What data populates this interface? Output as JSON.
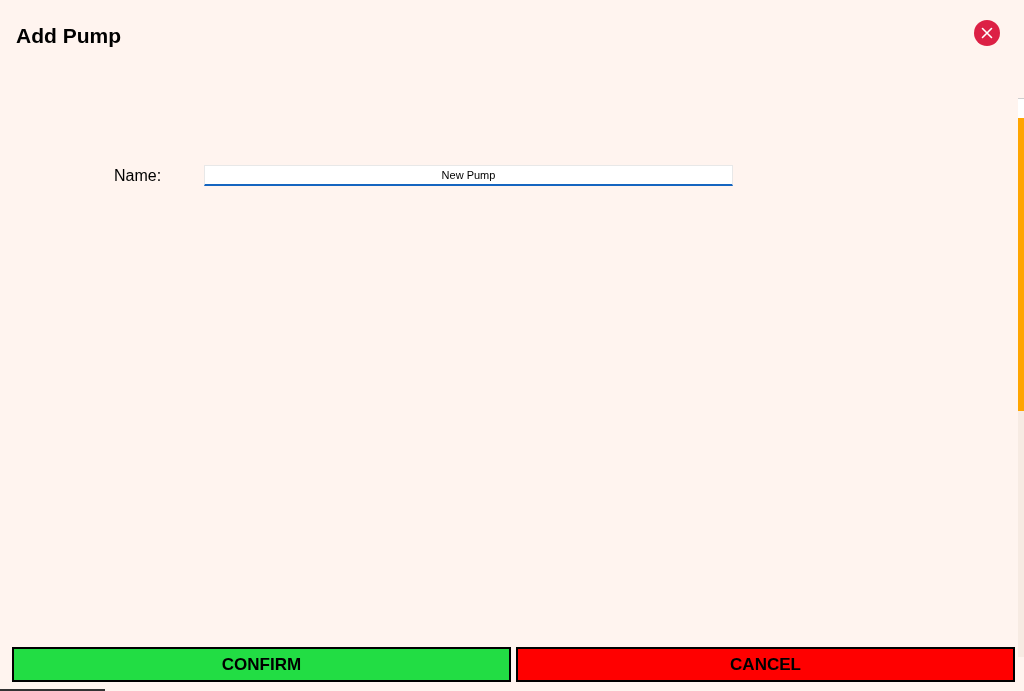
{
  "dialog": {
    "title": "Add Pump"
  },
  "form": {
    "fields": [
      {
        "label": "Name:",
        "value": "New Pump",
        "focused": true
      }
    ]
  },
  "buttons": [
    {
      "label": "CONFIRM",
      "kind": "confirm"
    },
    {
      "label": "CANCEL",
      "kind": "cancel"
    }
  ]
}
